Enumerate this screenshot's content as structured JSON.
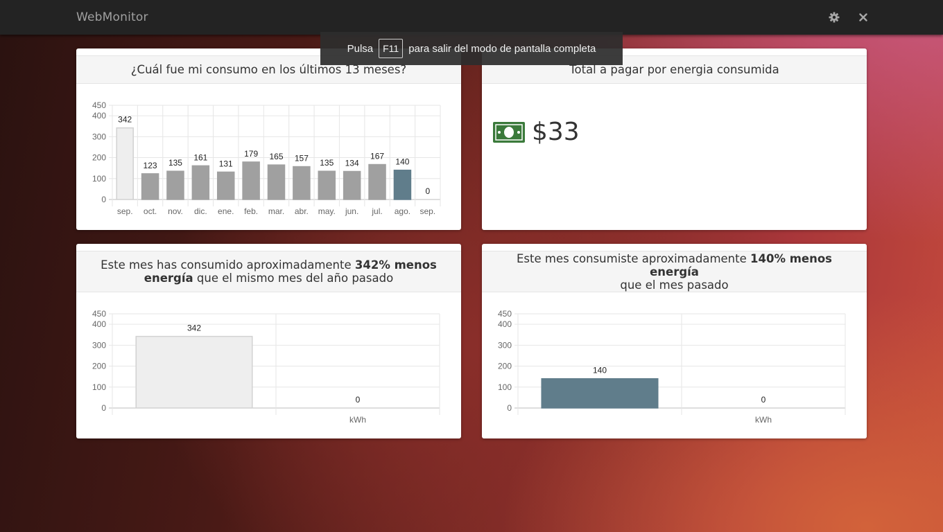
{
  "app": {
    "title": "WebMonitor"
  },
  "toolbar": {
    "settings_icon": "gear-icon",
    "close_icon": "close-icon"
  },
  "fullscreen_toast": {
    "prefix": "Pulsa",
    "key": "F11",
    "suffix": "para salir del modo de pantalla completa"
  },
  "cards": {
    "monthly": {
      "title": "¿Cuál fue mi consumo en los últimos 13 meses?"
    },
    "payment": {
      "title": "Total a pagar por energia consumida",
      "icon": "money-bill-icon",
      "amount": "$33",
      "icon_color": "#3b7a3b"
    },
    "year_compare": {
      "title_pre": "Este mes has consumido aproximadamente ",
      "title_bold1": "342% menos",
      "title_bold2": "energía",
      "title_post": " que el mismo mes del año pasado"
    },
    "month_compare": {
      "title_pre": "Este mes consumiste aproximadamente ",
      "title_bold": "140% menos energía",
      "title_post": "que el mes pasado"
    }
  },
  "chart_data": [
    {
      "type": "bar",
      "categories": [
        "sep.",
        "oct.",
        "nov.",
        "dic.",
        "ene.",
        "feb.",
        "mar.",
        "abr.",
        "may.",
        "jun.",
        "jul.",
        "ago.",
        "sep."
      ],
      "values": [
        342,
        123,
        135,
        161,
        131,
        179,
        165,
        157,
        135,
        134,
        167,
        140,
        0
      ],
      "bar_colors": [
        "#eeeeee",
        "#a0a0a0",
        "#a0a0a0",
        "#a0a0a0",
        "#a0a0a0",
        "#a0a0a0",
        "#a0a0a0",
        "#a0a0a0",
        "#a0a0a0",
        "#a0a0a0",
        "#a0a0a0",
        "#607d8b",
        "#a0a0a0"
      ],
      "yticks": [
        0,
        100,
        200,
        300,
        400,
        450
      ],
      "ylim": [
        0,
        450
      ],
      "grid": true,
      "xlabel": ""
    },
    {
      "type": "bar",
      "categories": [
        "",
        ""
      ],
      "values": [
        342,
        0
      ],
      "bar_colors": [
        "#eeeeee",
        "#a0a0a0"
      ],
      "yticks": [
        0,
        100,
        200,
        300,
        400,
        450
      ],
      "ylim": [
        0,
        450
      ],
      "grid": true,
      "xlabel": "kWh"
    },
    {
      "type": "bar",
      "categories": [
        "",
        ""
      ],
      "values": [
        140,
        0
      ],
      "bar_colors": [
        "#607d8b",
        "#a0a0a0"
      ],
      "yticks": [
        0,
        100,
        200,
        300,
        400,
        450
      ],
      "ylim": [
        0,
        450
      ],
      "grid": true,
      "xlabel": "kWh"
    }
  ]
}
